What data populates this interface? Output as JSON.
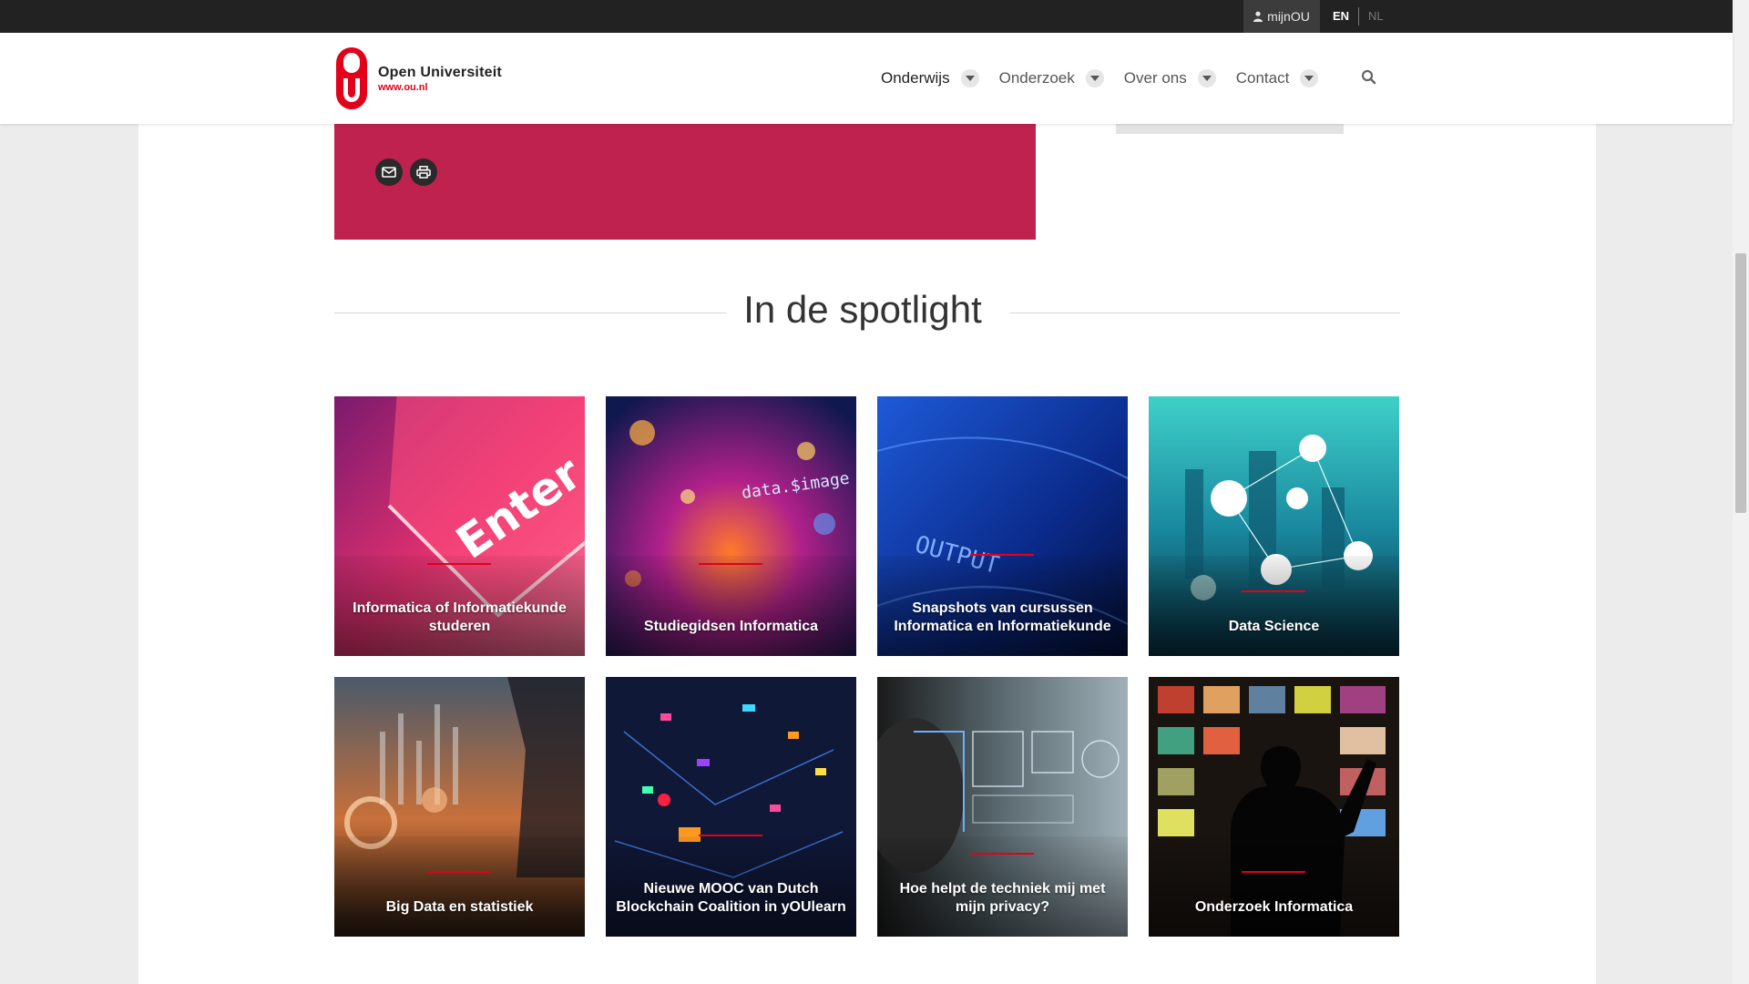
{
  "topbar": {
    "account_label": "mijnOU",
    "lang_en": "EN",
    "lang_nl": "NL"
  },
  "header": {
    "logo_name": "Open Universiteit",
    "logo_url": "www.ou.nl",
    "nav": [
      {
        "label": "Onderwijs"
      },
      {
        "label": "Onderzoek"
      },
      {
        "label": "Over ons"
      },
      {
        "label": "Contact"
      }
    ]
  },
  "share": {
    "icons": [
      "mail-icon",
      "print-icon"
    ]
  },
  "spotlight": {
    "title": "In de spotlight",
    "tiles": [
      {
        "caption": "Informatica of Informatiekunde studeren",
        "image_text": "Enter"
      },
      {
        "caption": "Studiegidsen Informatica",
        "image_text": "data.$image"
      },
      {
        "caption": "Snapshots van cursussen Informatica en Informatiekunde",
        "image_text": "OUTPUT"
      },
      {
        "caption": "Data Science"
      },
      {
        "caption": "Big Data en statistiek"
      },
      {
        "caption": "Nieuwe MOOC van Dutch Blockchain Coalition in yOUlearn"
      },
      {
        "caption": "Hoe helpt de techniek mij met mijn privacy?"
      },
      {
        "caption": "Onderzoek Informatica"
      }
    ]
  },
  "colors": {
    "brand_red": "#e2001a",
    "pink_box": "#c0224f",
    "topbar": "#222222"
  }
}
